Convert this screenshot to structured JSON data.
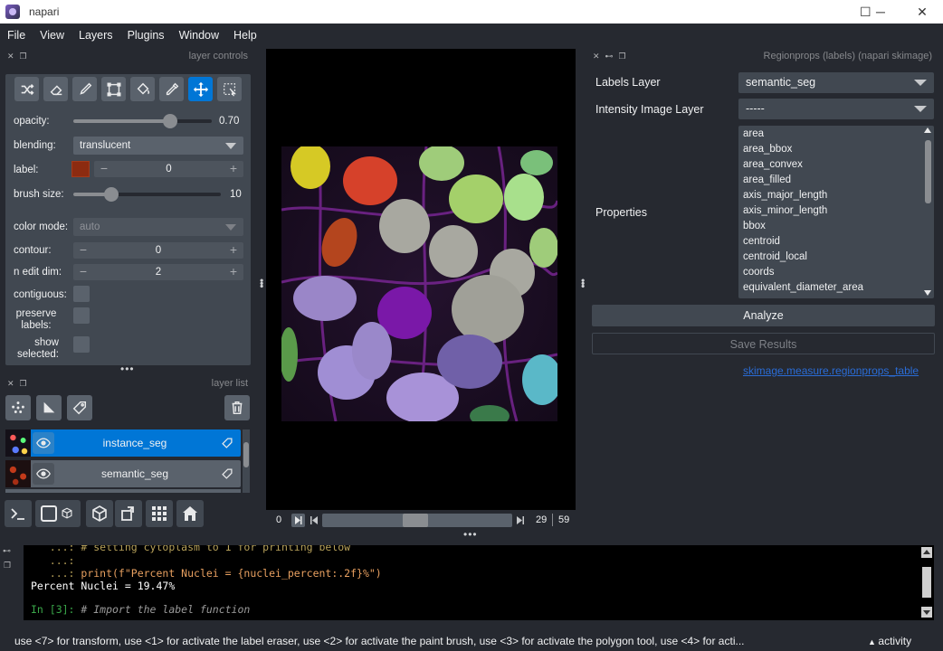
{
  "window": {
    "title": "napari",
    "minimize": "─",
    "maximize": "☐",
    "close": "✕"
  },
  "menu": [
    "File",
    "View",
    "Layers",
    "Plugins",
    "Window",
    "Help"
  ],
  "layer_controls": {
    "dock_title": "layer controls",
    "opacity_label": "opacity:",
    "opacity_value": "0.70",
    "opacity_fraction": 0.7,
    "blending_label": "blending:",
    "blending_value": "translucent",
    "label_label": "label:",
    "label_value": "0",
    "label_color": "#8c2b10",
    "brush_size_label": "brush size:",
    "brush_size_value": "10",
    "brush_fraction": 0.26,
    "color_mode_label": "color mode:",
    "color_mode_value": "auto",
    "contour_label": "contour:",
    "contour_value": "0",
    "n_edit_dim_label": "n edit dim:",
    "n_edit_dim_value": "2",
    "contiguous_label": "contiguous:",
    "preserve_labels_label": "preserve\nlabels:",
    "show_selected_label": "show\nselected:"
  },
  "layer_list": {
    "dock_title": "layer list",
    "layers": [
      {
        "name": "instance_seg",
        "selected": true
      },
      {
        "name": "semantic_seg",
        "selected": false
      }
    ]
  },
  "dims": {
    "current": "0",
    "value": "29",
    "total": "59",
    "slider_fraction": 0.49
  },
  "plugin": {
    "dock_title": "Regionprops (labels) (napari skimage)",
    "labels_layer_label": "Labels Layer",
    "labels_layer_value": "semantic_seg",
    "intensity_label": "Intensity Image Layer",
    "intensity_value": "-----",
    "properties_label": "Properties",
    "properties": [
      "area",
      "area_bbox",
      "area_convex",
      "area_filled",
      "axis_major_length",
      "axis_minor_length",
      "bbox",
      "centroid",
      "centroid_local",
      "coords",
      "equivalent_diameter_area"
    ],
    "analyze": "Analyze",
    "save": "Save Results",
    "link": "skimage.measure.regionprops_table"
  },
  "console": {
    "line0": "   ...: # setting cytoplasm to 1 for printing below",
    "line1_prompt": "   ...:",
    "line2_prompt": "   ...: ",
    "line2_code": "print(f\"Percent Nuclei = {nuclei_percent:.2f}%\")",
    "line3": "Percent Nuclei = 19.47%",
    "line4_prompt": "In [3]: ",
    "line4_comment": "# Import the label function"
  },
  "status": {
    "text": "use <7> for transform, use <1> for activate the label eraser, use <2> for activate the paint brush, use <3> for activate the polygon tool, use <4> for acti...",
    "activity": "activity"
  }
}
